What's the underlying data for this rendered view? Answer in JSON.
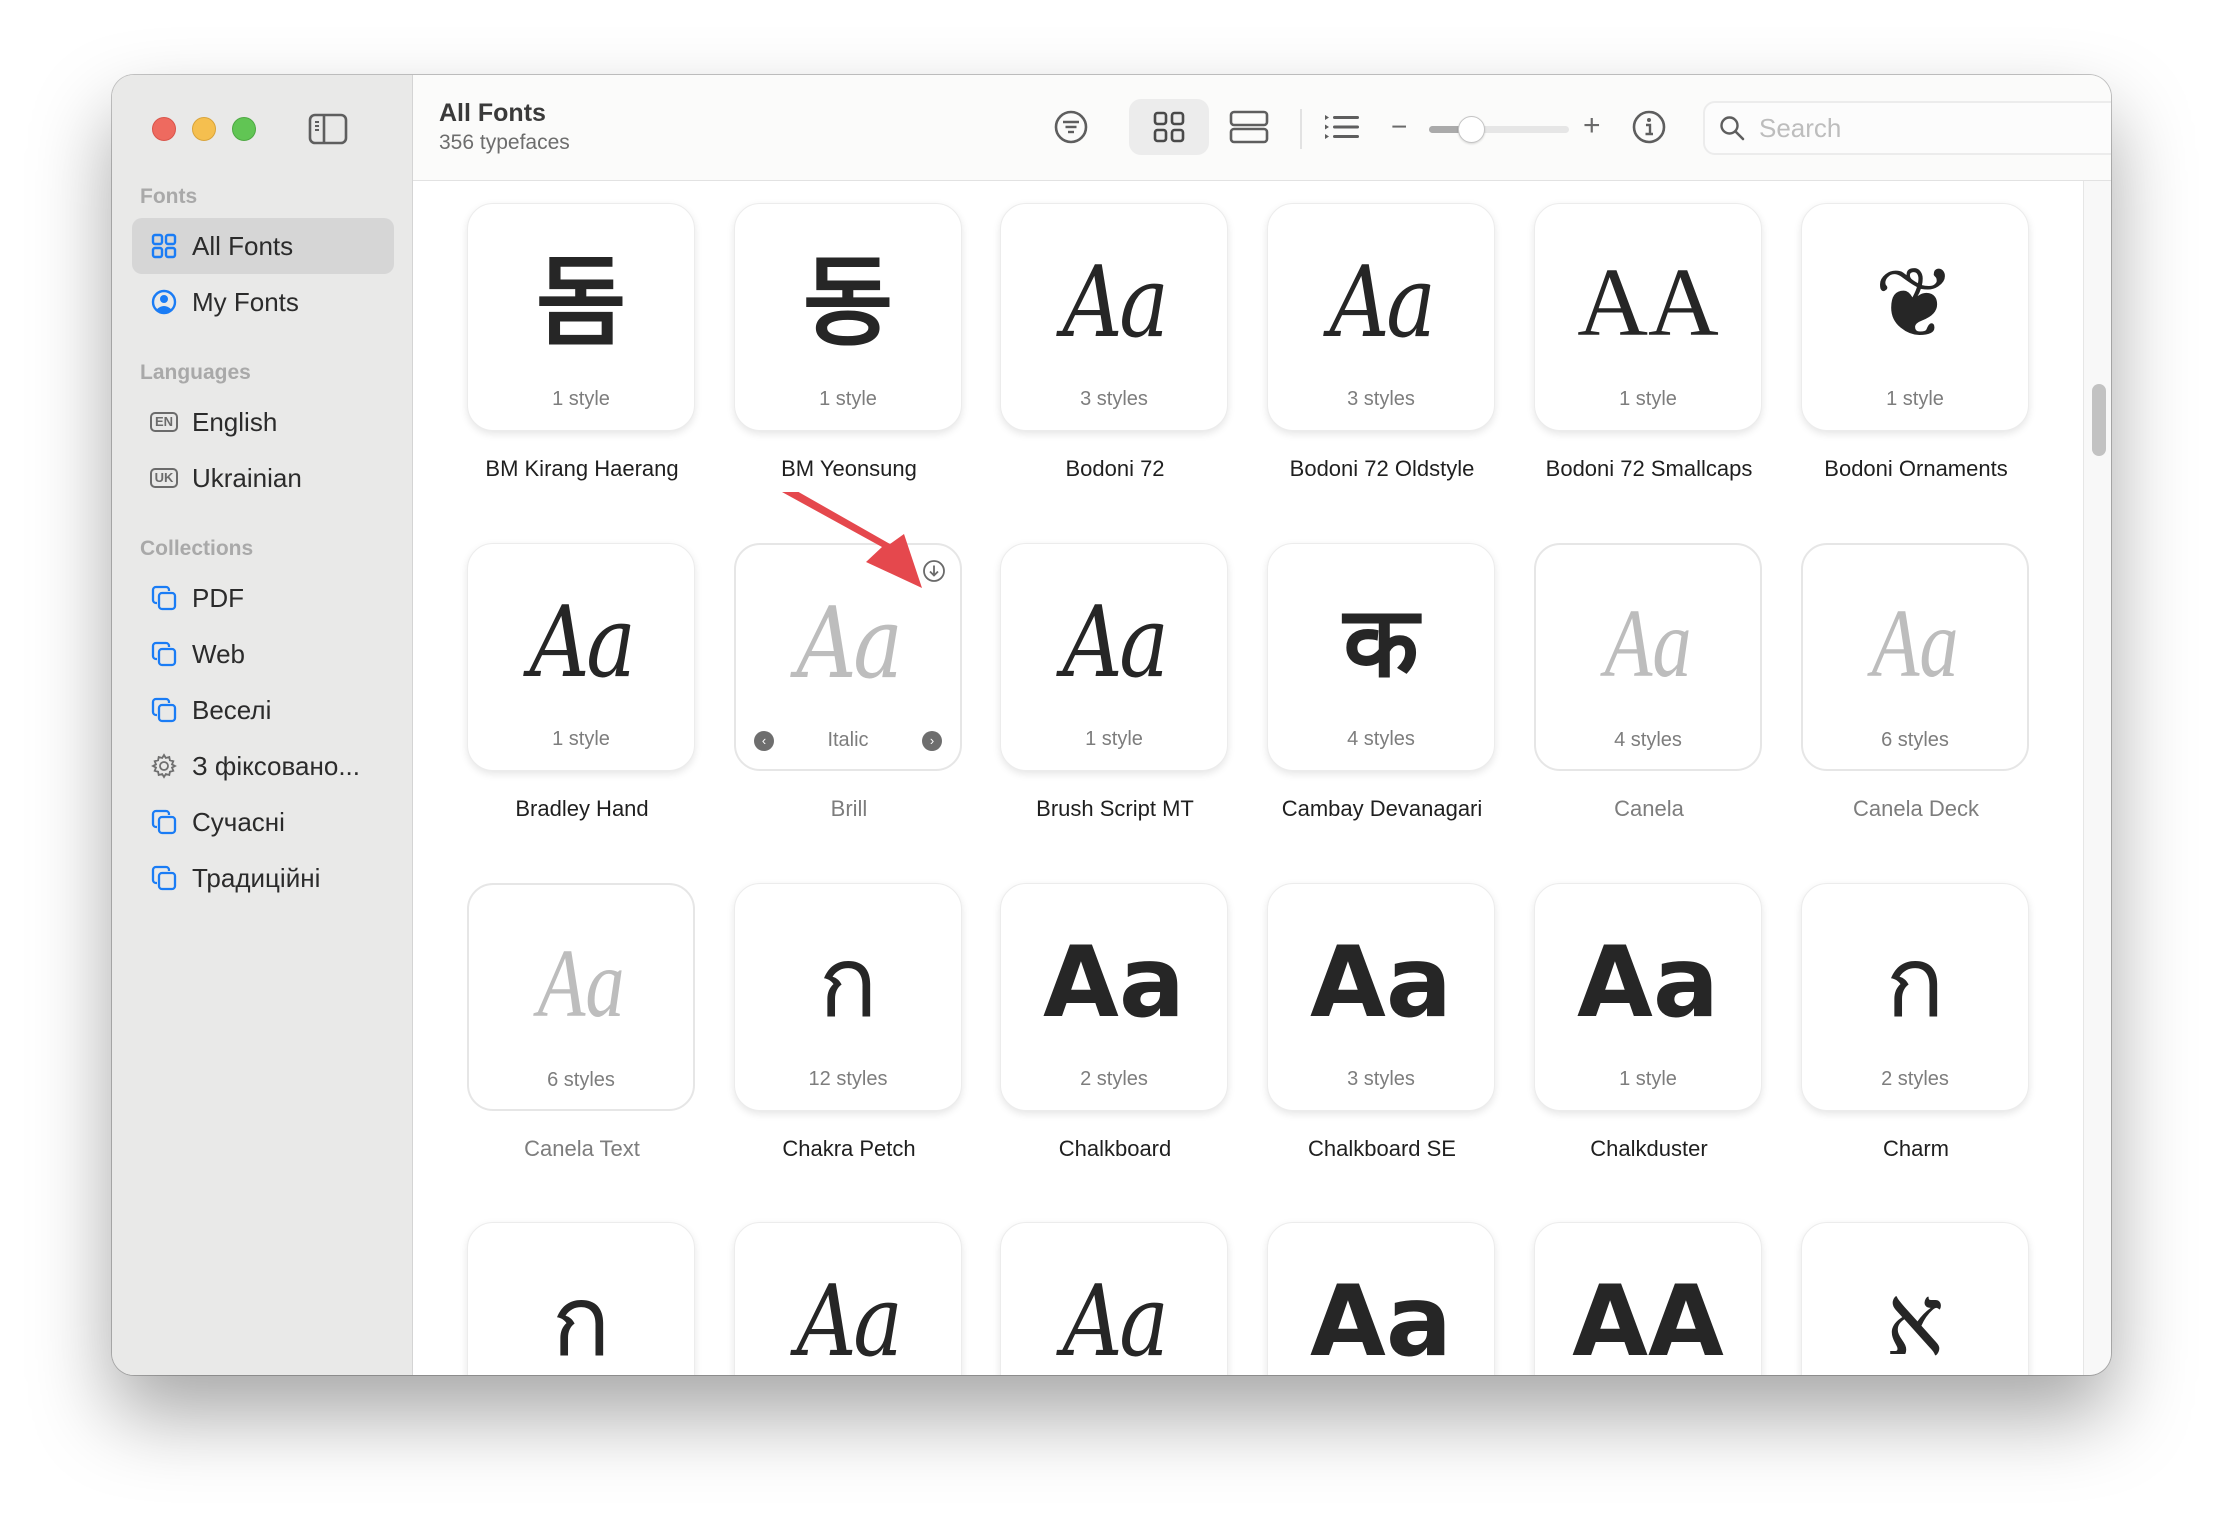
{
  "window": {
    "controls": {
      "close": "close",
      "minimize": "minimize",
      "zoom": "zoom"
    }
  },
  "sidebar": {
    "sections": [
      {
        "title": "Fonts",
        "items": [
          {
            "label": "All Fonts",
            "icon": "grid-icon",
            "selected": true
          },
          {
            "label": "My Fonts",
            "icon": "person-circle-icon",
            "selected": false
          }
        ]
      },
      {
        "title": "Languages",
        "items": [
          {
            "label": "English",
            "badge": "EN"
          },
          {
            "label": "Ukrainian",
            "badge": "UK"
          }
        ]
      },
      {
        "title": "Collections",
        "items": [
          {
            "label": "PDF",
            "icon": "collection-icon"
          },
          {
            "label": "Web",
            "icon": "collection-icon"
          },
          {
            "label": "Веселі",
            "icon": "collection-icon"
          },
          {
            "label": "З фіксовано...",
            "icon": "gear-icon"
          },
          {
            "label": "Сучасні",
            "icon": "collection-icon"
          },
          {
            "label": "Традиційні",
            "icon": "collection-icon"
          }
        ]
      }
    ]
  },
  "toolbar": {
    "title": "All Fonts",
    "subtitle": "356 typefaces",
    "view_mode": "grid",
    "size_slider_fraction": 0.3,
    "search_placeholder": "Search",
    "search_value": "",
    "slider_minus": "−",
    "slider_plus": "+"
  },
  "fonts": [
    {
      "name": "BM Kirang Haerang",
      "styles": "1 style",
      "glyph": "돔",
      "installed": true
    },
    {
      "name": "BM Yeonsung",
      "styles": "1 style",
      "glyph": "동",
      "installed": true
    },
    {
      "name": "Bodoni 72",
      "styles": "3 styles",
      "glyph": "Aa",
      "installed": true
    },
    {
      "name": "Bodoni 72 Oldstyle",
      "styles": "3 styles",
      "glyph": "Aa",
      "installed": true
    },
    {
      "name": "Bodoni 72 Smallcaps",
      "styles": "1 style",
      "glyph": "AA",
      "installed": true
    },
    {
      "name": "Bodoni Ornaments",
      "styles": "1 style",
      "glyph": "❦",
      "installed": true
    },
    {
      "name": "Bradley Hand",
      "styles": "1 style",
      "glyph": "Aa",
      "installed": true
    },
    {
      "name": "Brill",
      "styles": "Italic",
      "glyph": "Aa",
      "installed": false,
      "hovered": true,
      "download": true
    },
    {
      "name": "Brush Script MT",
      "styles": "1 style",
      "glyph": "Aa",
      "installed": true
    },
    {
      "name": "Cambay Devanagari",
      "styles": "4 styles",
      "glyph": "क",
      "installed": true
    },
    {
      "name": "Canela",
      "styles": "4 styles",
      "glyph": "Aa",
      "installed": false
    },
    {
      "name": "Canela Deck",
      "styles": "6 styles",
      "glyph": "Aa",
      "installed": false
    },
    {
      "name": "Canela Text",
      "styles": "6 styles",
      "glyph": "Aa",
      "installed": false
    },
    {
      "name": "Chakra Petch",
      "styles": "12 styles",
      "glyph": "ก",
      "installed": true
    },
    {
      "name": "Chalkboard",
      "styles": "2 styles",
      "glyph": "Aa",
      "installed": true
    },
    {
      "name": "Chalkboard SE",
      "styles": "3 styles",
      "glyph": "Aa",
      "installed": true
    },
    {
      "name": "Chalkduster",
      "styles": "1 style",
      "glyph": "Aa",
      "installed": true
    },
    {
      "name": "Charm",
      "styles": "2 styles",
      "glyph": "ก",
      "installed": true
    },
    {
      "name": "",
      "styles": "",
      "glyph": "ก",
      "installed": true
    },
    {
      "name": "",
      "styles": "",
      "glyph": "Aa",
      "installed": true
    },
    {
      "name": "",
      "styles": "",
      "glyph": "Aa",
      "installed": true
    },
    {
      "name": "",
      "styles": "",
      "glyph": "Aa",
      "installed": true
    },
    {
      "name": "",
      "styles": "",
      "glyph": "AA",
      "installed": true
    },
    {
      "name": "",
      "styles": "",
      "glyph": "א",
      "installed": true
    }
  ],
  "annotation": {
    "type": "arrow",
    "color": "#e5484d",
    "points_to": "Brill download button"
  }
}
